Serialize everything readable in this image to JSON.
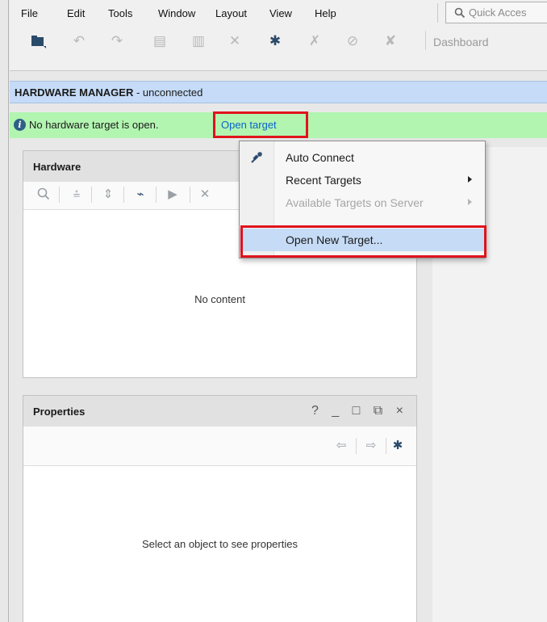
{
  "menu": {
    "items": [
      "File",
      "Edit",
      "Tools",
      "Window",
      "Layout",
      "View",
      "Help"
    ],
    "quick_access_placeholder": "Quick Acces"
  },
  "toolbar": {
    "icons": [
      "open-project-icon",
      "undo-icon",
      "redo-icon",
      "copy-icon",
      "paste-icon",
      "delete-icon",
      "settings-icon",
      "auto-fix-icon",
      "disable-icon",
      "delete-x-icon"
    ],
    "dashboard_label": "Dashboard"
  },
  "hardware_manager": {
    "title_bold": "HARDWARE MANAGER",
    "title_status": " - unconnected"
  },
  "info_bar": {
    "message": "No hardware target is open.",
    "link": "Open target"
  },
  "hardware_panel": {
    "title": "Hardware",
    "empty_text": "No content"
  },
  "context_menu": {
    "items": [
      {
        "label": "Auto Connect",
        "icon": "auto-connect-icon",
        "submenu": false,
        "disabled": false
      },
      {
        "label": "Recent Targets",
        "submenu": true,
        "disabled": false
      },
      {
        "label": "Available Targets on Server",
        "submenu": true,
        "disabled": true
      },
      {
        "label": "Open New Target...",
        "submenu": false,
        "disabled": false,
        "selected": true
      }
    ]
  },
  "properties_panel": {
    "title": "Properties",
    "controls": "? _ □ ⧉ ×",
    "empty_text": "Select an object to see properties"
  },
  "colors": {
    "info_bar_bg": "#b2f5b0",
    "title_bar_bg": "#c5dbf7",
    "highlight": "#e0131c",
    "link": "#0a63c9",
    "menu_selected": "#c6dcf6"
  }
}
